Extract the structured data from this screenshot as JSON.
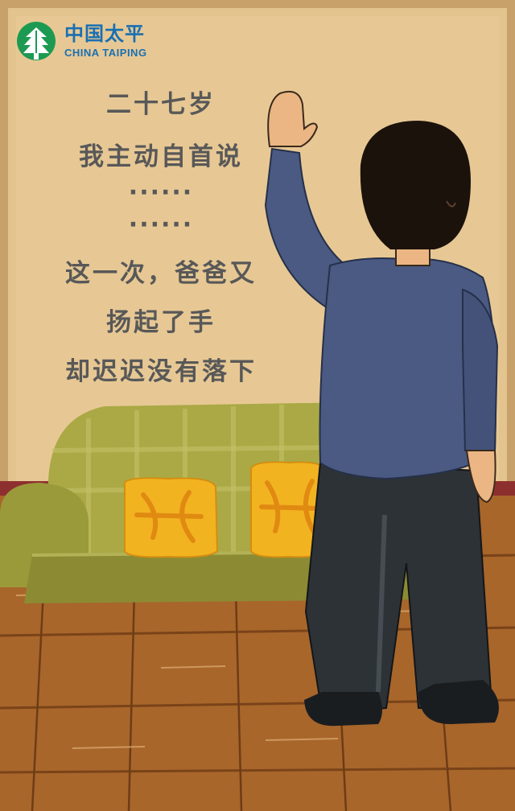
{
  "brand": {
    "name_cn": "中国太平",
    "name_en": "CHINA TAIPING",
    "color": "#1a6fb2",
    "logo_icon": "pine-tree-icon"
  },
  "story": {
    "lines": [
      "二十七岁",
      "我主动自首说",
      "······",
      "······",
      "这一次，爸爸又",
      "扬起了手",
      "却迟迟没有落下"
    ],
    "text_color": "#585858"
  },
  "scene": {
    "wall_color": "#e6c690",
    "floor_color": "#a8662b",
    "sofa_color": "#a5a63e",
    "cushion_color": "#f2b321",
    "sweater_color": "#4a5a82",
    "pants_color": "#2d3236",
    "hair_color": "#1c120c",
    "skin_color": "#ebb683"
  }
}
